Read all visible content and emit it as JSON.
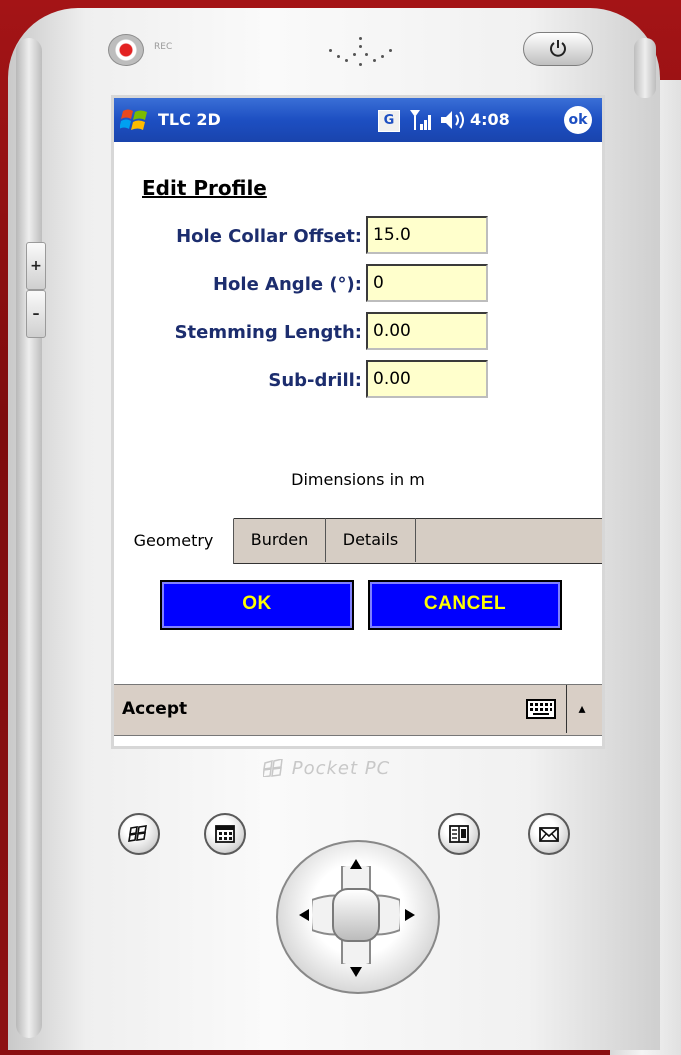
{
  "device": {
    "rec_label": "REC",
    "brand": "Pocket PC",
    "side_plus": "+",
    "side_minus": "–"
  },
  "titlebar": {
    "app_name": "TLC 2D",
    "network_label": "G",
    "time": "4:08",
    "ok_label": "ok"
  },
  "form": {
    "title": "Edit Profile",
    "fields": [
      {
        "label": "Hole Collar Offset:",
        "value": "15.0"
      },
      {
        "label": "Hole Angle (°):",
        "value": "0"
      },
      {
        "label": "Stemming Length:",
        "value": "0.00"
      },
      {
        "label": "Sub-drill:",
        "value": "0.00"
      }
    ],
    "units_note": "Dimensions in m"
  },
  "tabs": [
    {
      "label": "Geometry",
      "active": true
    },
    {
      "label": "Burden",
      "active": false
    },
    {
      "label": "Details",
      "active": false
    }
  ],
  "buttons": {
    "ok": "OK",
    "cancel": "CANCEL"
  },
  "menubar": {
    "left_softkey": "Accept",
    "sip_arrow": "▴"
  },
  "colors": {
    "titlebar": "#1d4fc2",
    "input_bg": "#ffffcc",
    "button_bg": "#0000ff",
    "button_text": "#ffff00",
    "label_text": "#1c2d6e",
    "menubar_bg": "#d9cfc6",
    "slide_bg": "#8a0e10"
  },
  "icons": [
    "windows-start-icon",
    "network-g-icon",
    "signal-icon",
    "volume-icon",
    "ok-icon",
    "keyboard-icon",
    "home-icon",
    "calendar-icon",
    "contacts-icon",
    "mail-icon",
    "power-icon"
  ]
}
